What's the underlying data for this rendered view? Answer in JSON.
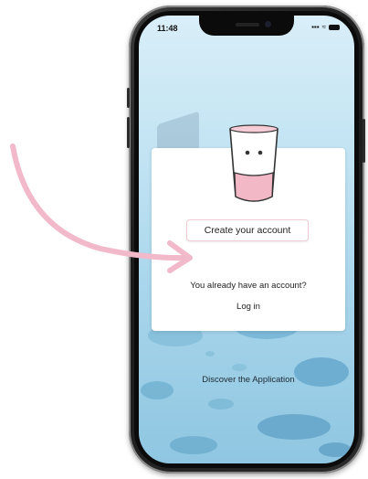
{
  "status_bar": {
    "time": "11:48"
  },
  "onboarding": {
    "create_account_label": "Create your account",
    "have_account_text": "You already have an account?",
    "login_label": "Log in",
    "discover_label": "Discover the Application"
  },
  "colors": {
    "accent_pink": "#f2b8c6",
    "arrow_pink": "#f1b9c9",
    "phone_frame": "#1a1a1a",
    "background_top": "#d9eef8",
    "background_bottom": "#8fc6e1"
  },
  "icons": [
    "arrow-annotation-icon",
    "cup-mascot-icon",
    "signal-icon",
    "wifi-icon",
    "battery-icon"
  ]
}
